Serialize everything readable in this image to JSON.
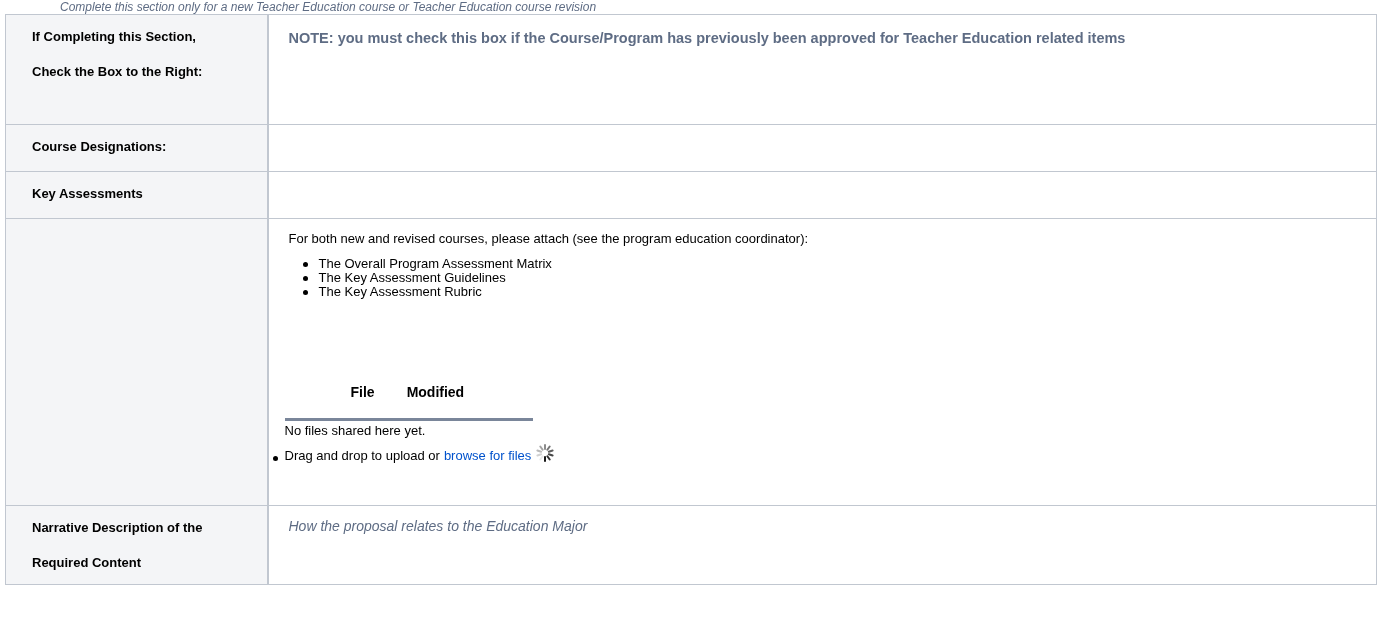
{
  "intro_note": "Complete this section only for a new Teacher Education course or Teacher Education course revision",
  "rows": [
    {
      "kind": "note",
      "label_lines": [
        "If Completing this Section,",
        "Check the Box to the Right:"
      ],
      "note": "NOTE: you must check this box if the Course/Program has previously been approved for Teacher Education related items"
    },
    {
      "kind": "empty",
      "label_lines": [
        "Course Designations:"
      ]
    },
    {
      "kind": "empty",
      "label_lines": [
        "Key Assessments"
      ]
    },
    {
      "kind": "attachments",
      "label_lines": [],
      "intro": "For both new and revised courses, please attach (see the program education coordinator):",
      "bullets": [
        "The Overall Program Assessment Matrix",
        "The Key Assessment Guidelines",
        "The Key Assessment Rubric"
      ],
      "file_columns": [
        "File",
        "Modified"
      ],
      "empty_message": "No files shared here yet.",
      "upload_text": "Drag and drop to upload or",
      "upload_link": "browse for files"
    },
    {
      "kind": "placeholder",
      "label_lines": [
        "Narrative Description of the",
        "Required Content"
      ],
      "placeholder": "How the proposal relates to the Education Major"
    }
  ]
}
